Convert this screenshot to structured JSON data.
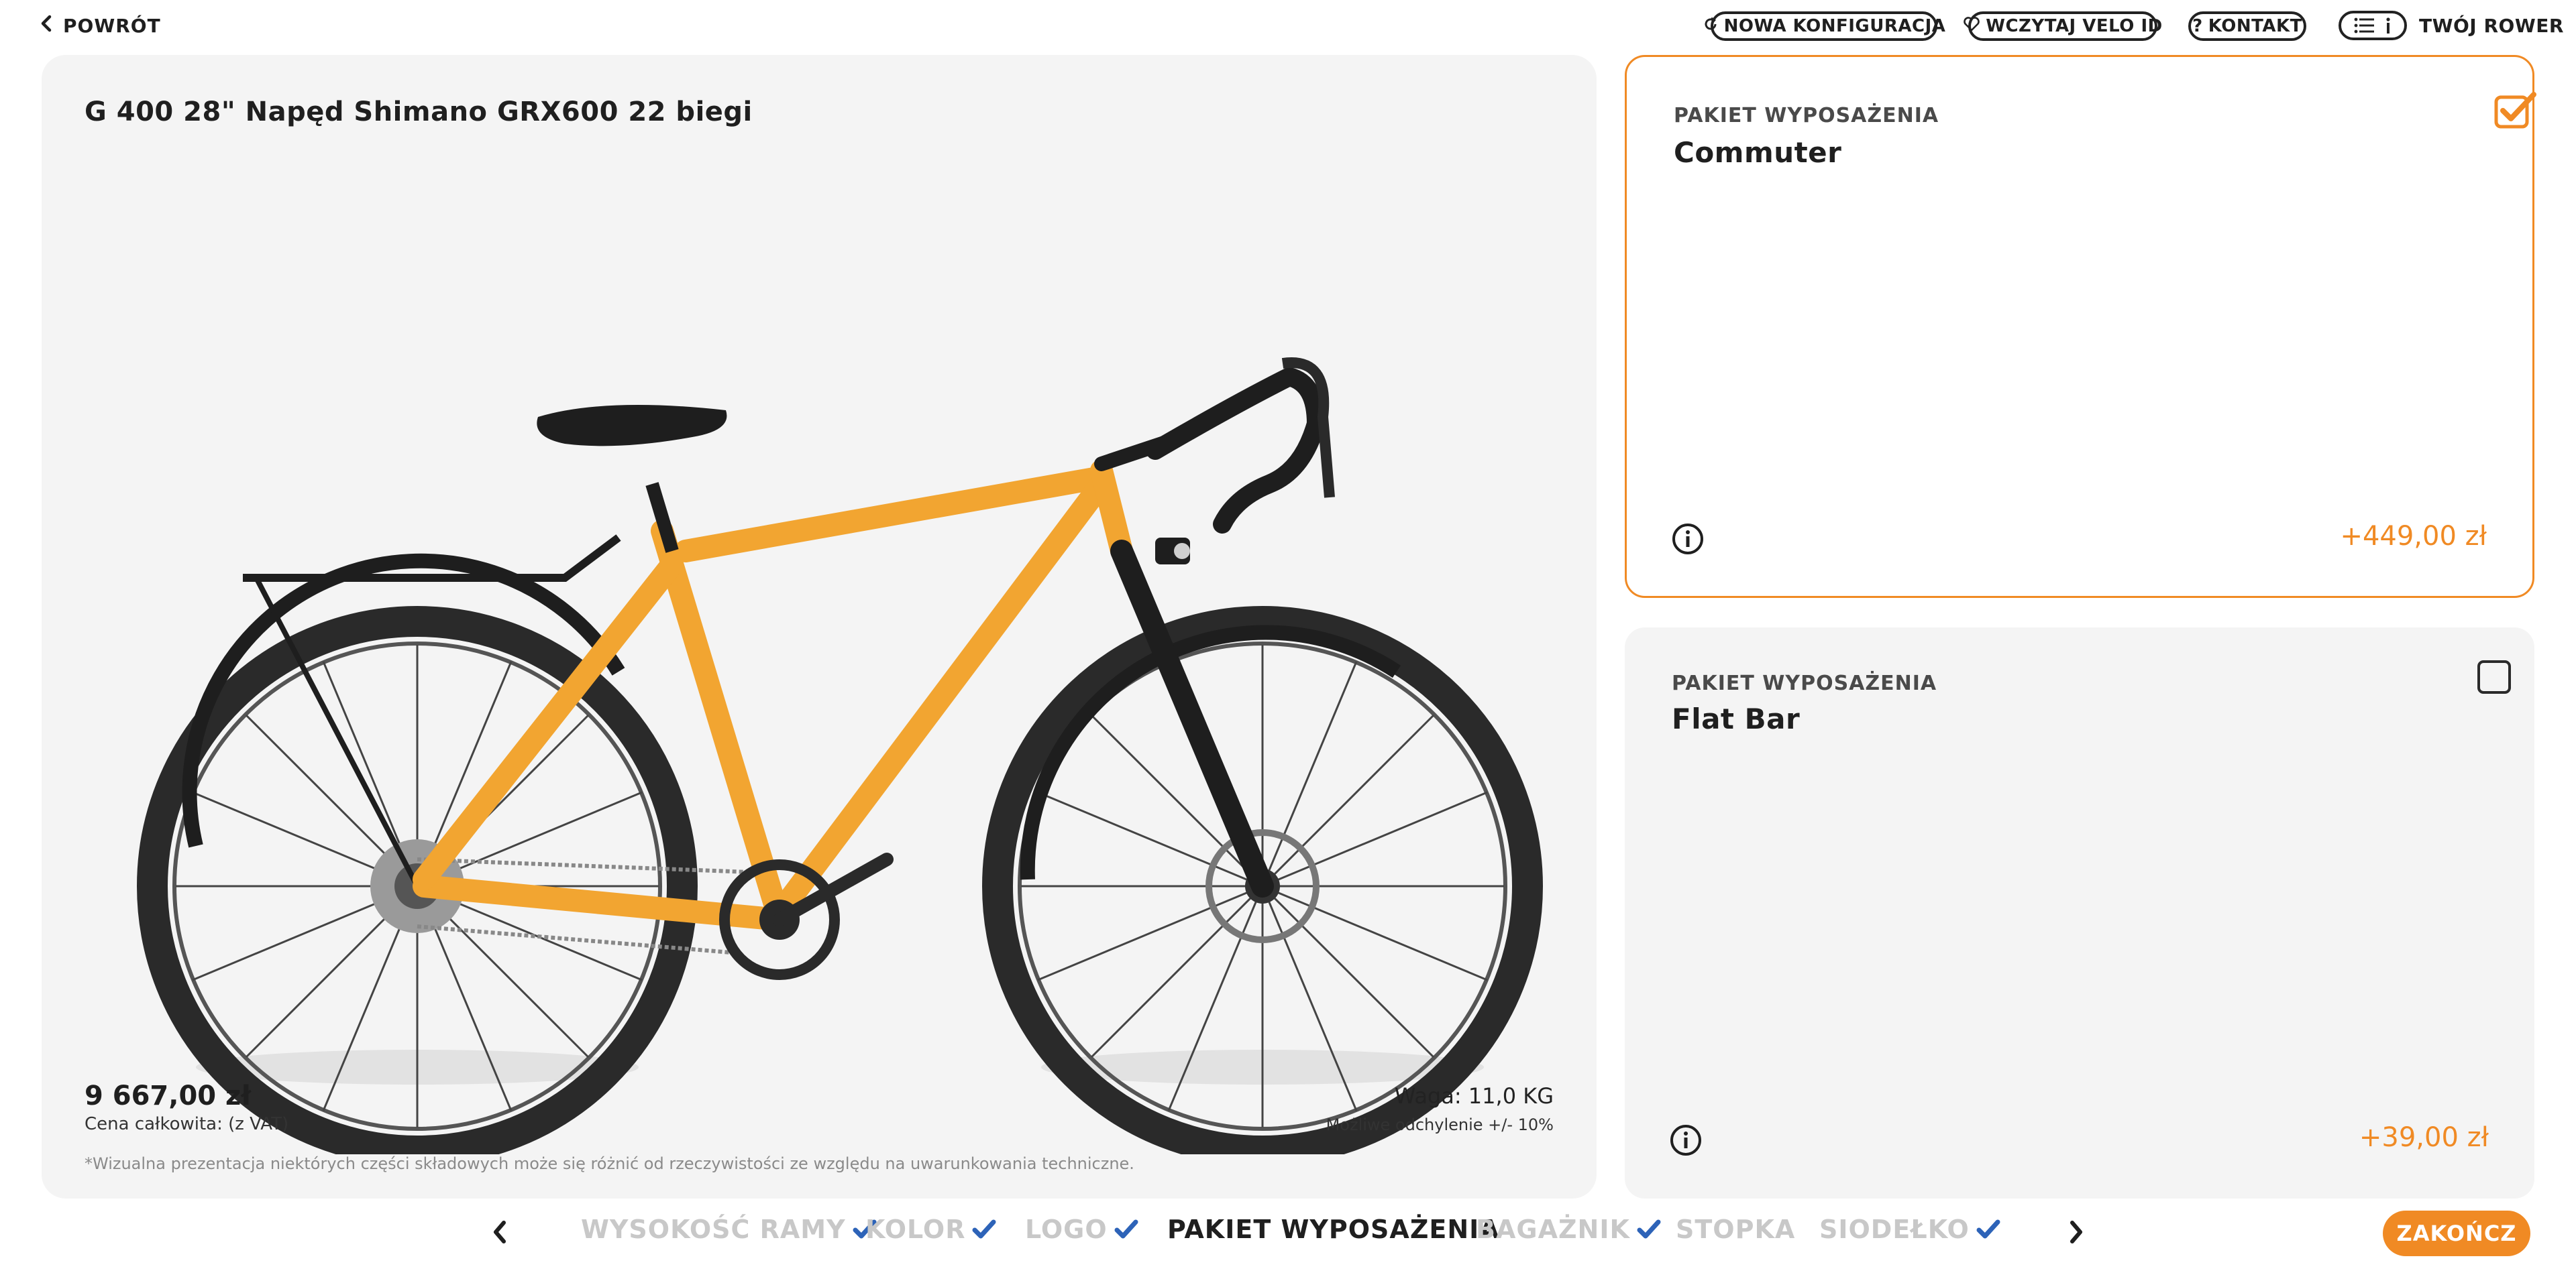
{
  "header": {
    "back_label": "POWRÓT",
    "new_config_label": "NOWA KONFIGURACJA",
    "load_velo_id_label": "WCZYTAJ VELO ID",
    "contact_label": "KONTAKT",
    "your_bike_label": "TWÓJ ROWER"
  },
  "product": {
    "title": "G 400 28\" Napęd Shimano GRX600 22 biegi",
    "price": "9 667,00 zł",
    "price_note": "Cena całkowita: (z VAT)",
    "weight": "Waga: 11,0 KG",
    "deviation": "Możliwe odchylenie +/- 10%",
    "disclaimer": "*Wizualna prezentacja niektórych części składowych może się różnić od rzeczywistości ze względu na uwarunkowania techniczne.",
    "frame_color": "#f2a531"
  },
  "options": [
    {
      "category": "PAKIET WYPOSAŻENIA",
      "name": "Commuter",
      "price": "+449,00 zł",
      "selected": true
    },
    {
      "category": "PAKIET WYPOSAŻENIA",
      "name": "Flat Bar",
      "price": "+39,00 zł",
      "selected": false
    }
  ],
  "steps": [
    {
      "label": "WYSOKOŚĆ RAMY",
      "state": "done"
    },
    {
      "label": "KOLOR",
      "state": "done"
    },
    {
      "label": "LOGO",
      "state": "done"
    },
    {
      "label": "PAKIET WYPOSAŻENIA",
      "state": "active"
    },
    {
      "label": "BAGAŻNIK",
      "state": "done"
    },
    {
      "label": "STOPKA",
      "state": "pending"
    },
    {
      "label": "SIODEŁKO",
      "state": "done"
    }
  ],
  "finish_label": "ZAKOŃCZ",
  "colors": {
    "accent": "#f08a24",
    "check_blue": "#2d63b8",
    "panel_bg": "#f4f4f4"
  }
}
